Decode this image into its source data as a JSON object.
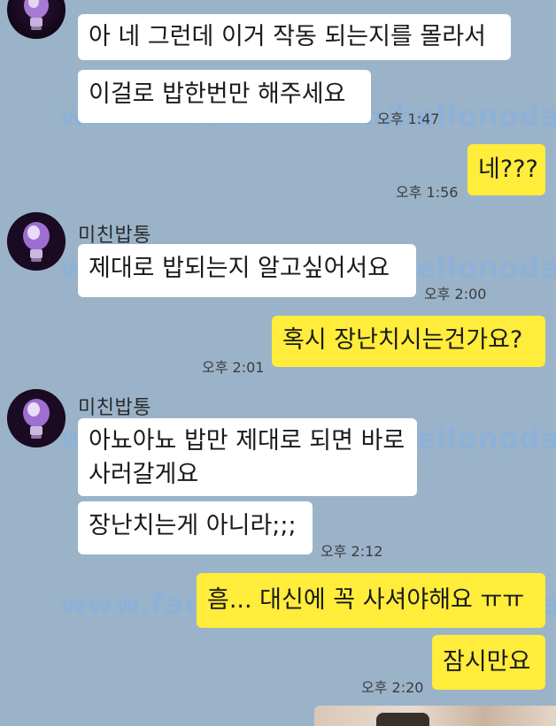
{
  "watermark": "www.facebook.com/hellonodap",
  "sender_name": "미친밥통",
  "messages": [
    {
      "dir": "in",
      "text": "아 네 그런데 이거 작동 되는지를 몰라서"
    },
    {
      "dir": "in",
      "text": "이걸로 밥한번만 해주세요",
      "time": "오후 1:47"
    },
    {
      "dir": "out",
      "text": "네???",
      "time": "오후 1:56"
    },
    {
      "dir": "in",
      "text": "제대로 밥되는지 알고싶어서요",
      "time": "오후 2:00"
    },
    {
      "dir": "out",
      "text": "혹시 장난치시는건가요?",
      "time": "오후 2:01"
    },
    {
      "dir": "in",
      "text": "아뇨아뇨 밥만 제대로 되면 바로",
      "text2": "사러갈게요"
    },
    {
      "dir": "in",
      "text": "장난치는게 아니라;;;",
      "time": "오후 2:12"
    },
    {
      "dir": "out",
      "text": "흠... 대신에 꼭 사셔야해요 ㅠㅠ"
    },
    {
      "dir": "out",
      "text": "잠시만요",
      "time": "오후 2:20"
    }
  ],
  "colors": {
    "background": "#9bb3c9",
    "incoming_bubble": "#ffffff",
    "outgoing_bubble": "#ffec3b"
  },
  "icons": {
    "avatar": "light-bulb-avatar-icon"
  }
}
